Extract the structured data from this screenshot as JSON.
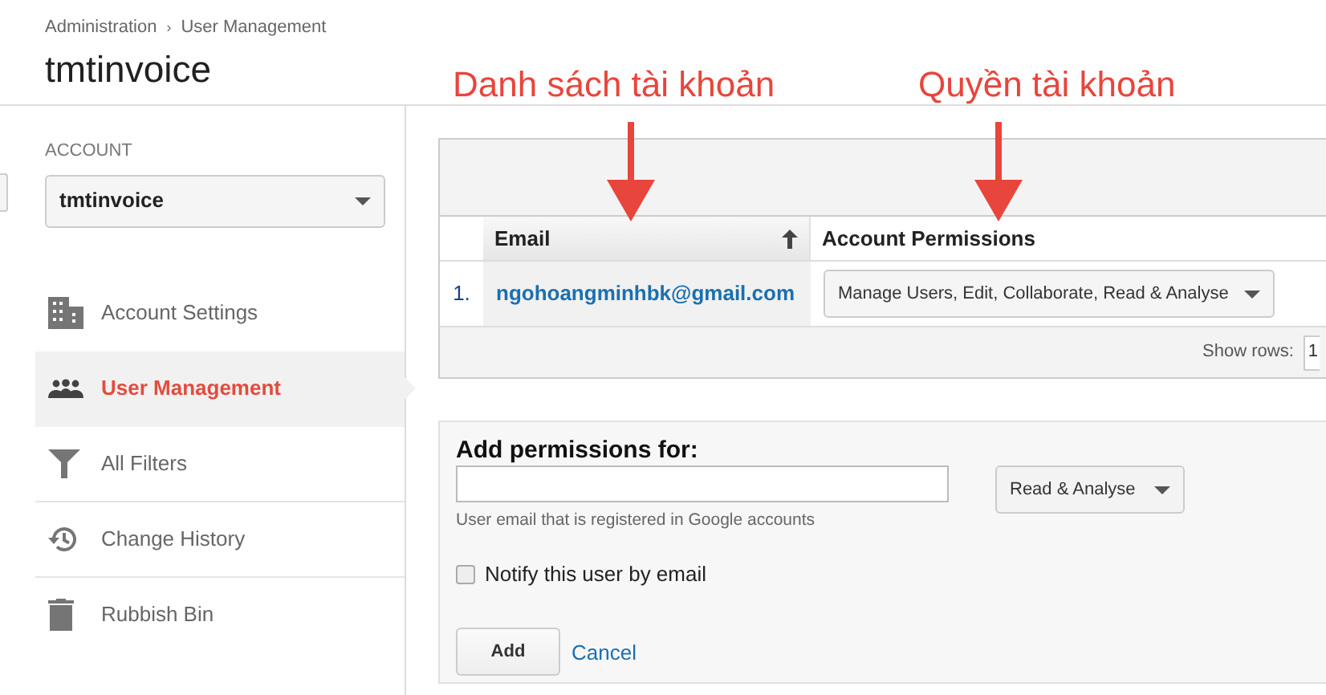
{
  "breadcrumb": [
    "Administration",
    "User Management"
  ],
  "breadcrumb_separator": "›",
  "title": "tmtinvoice",
  "sidebar": {
    "section_label": "ACCOUNT",
    "account_select": "tmtinvoice",
    "items": [
      {
        "label": "Account Settings",
        "kind": "building",
        "selected": false
      },
      {
        "label": "User Management",
        "kind": "people",
        "selected": true
      },
      {
        "label": "All Filters",
        "kind": "filter",
        "selected": false
      },
      {
        "label": "Change History",
        "kind": "history",
        "selected": false
      },
      {
        "label": "Rubbish Bin",
        "kind": "trash",
        "selected": false
      }
    ]
  },
  "annotations": [
    {
      "text": "Danh sách tài khoản"
    },
    {
      "text": "Quyền tài khoản"
    }
  ],
  "table": {
    "columns": [
      {
        "label": "Email",
        "sorted": true
      },
      {
        "label": "Account Permissions",
        "sorted": false
      }
    ],
    "rows": [
      {
        "index": "1.",
        "email": "ngohoangminhbk@gmail.com",
        "permissions": "Manage Users, Edit, Collaborate, Read & Analyse"
      }
    ],
    "show_rows_label": "Show rows:",
    "show_rows_value": "1"
  },
  "add_form": {
    "title": "Add permissions for:",
    "hint": "User email that is registered in Google accounts",
    "permission": "Read & Analyse",
    "notify_label": "Notify this user by email",
    "notify_checked": false,
    "add_button": "Add",
    "cancel_link": "Cancel"
  }
}
